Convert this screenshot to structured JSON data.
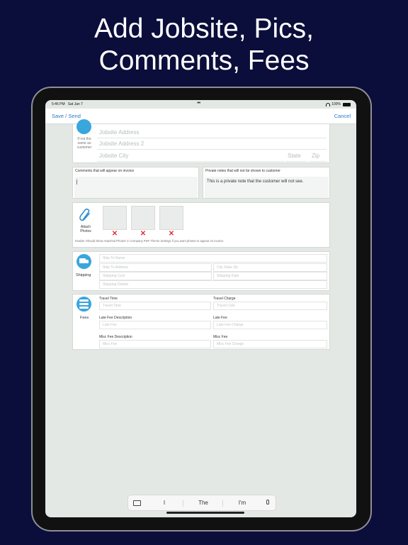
{
  "headline": {
    "line1": "Add Jobsite, Pics,",
    "line2": "Comments, Fees"
  },
  "status": {
    "time": "5:46 PM",
    "date": "Sat Jan 7",
    "battery": "100%"
  },
  "nav": {
    "save": "Save / Send",
    "cancel": "Cancel"
  },
  "jobsite": {
    "note": "If not the same as customer",
    "address": "Jobsite Address",
    "address2": "Jobsite Address 2",
    "city": "Jobsite City",
    "state": "State",
    "zip": "Zip"
  },
  "comments": {
    "invoice_label": "Comments that will appear on invoice",
    "private_label": "Private notes that will not be shown to customer",
    "private_value": "This is a private note that the customer will not see."
  },
  "photos": {
    "label": "Attach Photos",
    "hint": "Enable 'Should Show Attached Photos' in Company PDF Theme Settings if you want photos to appear on invoice"
  },
  "shipping": {
    "label": "Shipping",
    "name": "Ship To Name",
    "address": "Ship To Address",
    "city_state_zip": "City State Zip",
    "cost": "Shipping Cost",
    "date": "Shipping Date",
    "details": "Shipping Details"
  },
  "fees": {
    "label": "Fees",
    "travel_time_label": "Travel Time",
    "travel_time_placeholder": "Travel Time",
    "travel_charge_label": "Travel Charge",
    "travel_charge_placeholder": "Travel Cost",
    "late_desc_label": "Late Fee Description",
    "late_desc_placeholder": "Late Fee",
    "late_fee_label": "Late Fee",
    "late_fee_placeholder": "Late Fee Charge",
    "misc_desc_label": "Misc Fee Description",
    "misc_desc_placeholder": "Misc Fee",
    "misc_fee_label": "Misc Fee",
    "misc_fee_placeholder": "Misc Fee Charge"
  },
  "keyboard": {
    "suggestion1": "I",
    "suggestion2": "The",
    "suggestion3": "I'm"
  }
}
